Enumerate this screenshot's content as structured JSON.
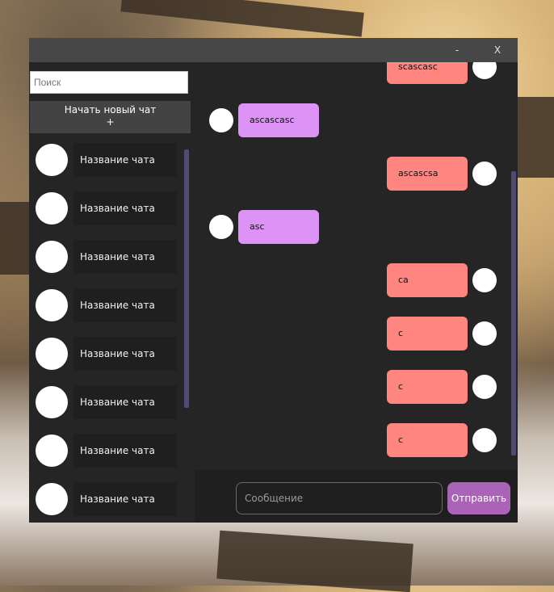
{
  "window": {
    "minimize_label": "-",
    "close_label": "X"
  },
  "sidebar": {
    "search_placeholder": "Поиск",
    "new_chat_label": "Начать новый чат",
    "new_chat_plus": "+",
    "chats": [
      {
        "name": "Название чата"
      },
      {
        "name": "Название чата"
      },
      {
        "name": "Название чата"
      },
      {
        "name": "Название чата"
      },
      {
        "name": "Название чата"
      },
      {
        "name": "Название чата"
      },
      {
        "name": "Название чата"
      },
      {
        "name": "Название чата"
      }
    ]
  },
  "messages": [
    {
      "text": "scascasc",
      "direction": "out"
    },
    {
      "text": "ascascasc",
      "direction": "in"
    },
    {
      "text": "ascascsa",
      "direction": "out"
    },
    {
      "text": "asc",
      "direction": "in"
    },
    {
      "text": "ca",
      "direction": "out"
    },
    {
      "text": "c",
      "direction": "out"
    },
    {
      "text": "c",
      "direction": "out"
    },
    {
      "text": "c",
      "direction": "out"
    }
  ],
  "composer": {
    "placeholder": "Сообщение",
    "send_label": "Отправить"
  },
  "colors": {
    "outgoing": "#ff8580",
    "incoming": "#dd93f5",
    "accent": "#ab63b8",
    "scrollbar": "#4e4b74"
  }
}
